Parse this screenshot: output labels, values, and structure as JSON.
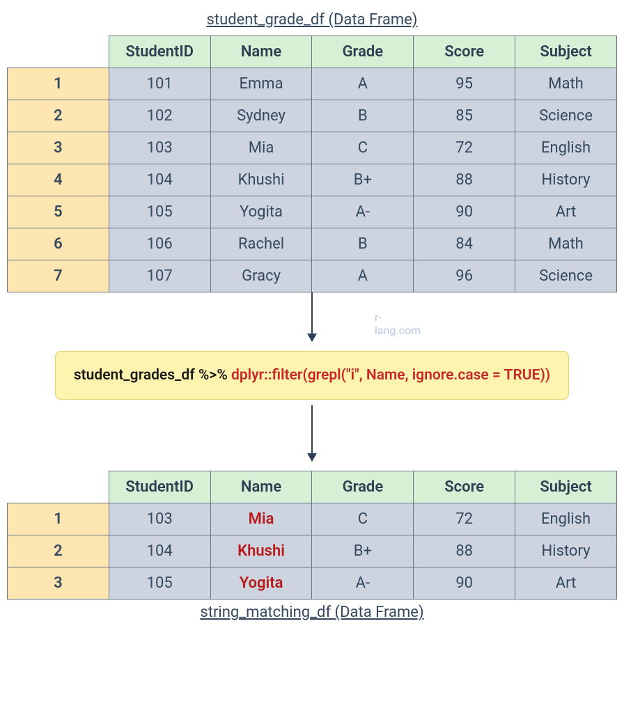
{
  "top_caption": "student_grade_df (Data Frame)",
  "bottom_caption": "string_matching_df (Data Frame)",
  "watermark": "r-lang.com",
  "columns": [
    "StudentID",
    "Name",
    "Grade",
    "Score",
    "Subject"
  ],
  "source_rows": [
    {
      "idx": "1",
      "StudentID": "101",
      "Name": "Emma",
      "Grade": "A",
      "Score": "95",
      "Subject": "Math"
    },
    {
      "idx": "2",
      "StudentID": "102",
      "Name": "Sydney",
      "Grade": "B",
      "Score": "85",
      "Subject": "Science"
    },
    {
      "idx": "3",
      "StudentID": "103",
      "Name": "Mia",
      "Grade": "C",
      "Score": "72",
      "Subject": "English"
    },
    {
      "idx": "4",
      "StudentID": "104",
      "Name": "Khushi",
      "Grade": "B+",
      "Score": "88",
      "Subject": "History"
    },
    {
      "idx": "5",
      "StudentID": "105",
      "Name": "Yogita",
      "Grade": "A-",
      "Score": "90",
      "Subject": "Art"
    },
    {
      "idx": "6",
      "StudentID": "106",
      "Name": "Rachel",
      "Grade": "B",
      "Score": "84",
      "Subject": "Math"
    },
    {
      "idx": "7",
      "StudentID": "107",
      "Name": "Gracy",
      "Grade": "A",
      "Score": "96",
      "Subject": "Science"
    }
  ],
  "result_rows": [
    {
      "idx": "1",
      "StudentID": "103",
      "Name": "Mia",
      "Grade": "C",
      "Score": "72",
      "Subject": "English"
    },
    {
      "idx": "2",
      "StudentID": "104",
      "Name": "Khushi",
      "Grade": "B+",
      "Score": "88",
      "Subject": "History"
    },
    {
      "idx": "3",
      "StudentID": "105",
      "Name": "Yogita",
      "Grade": "A-",
      "Score": "90",
      "Subject": "Art"
    }
  ],
  "code": {
    "black": "student_grades_df %>% ",
    "red": "dplyr::filter(grepl(\"i\", Name, ignore.case = TRUE))"
  },
  "highlight_column": "Name"
}
